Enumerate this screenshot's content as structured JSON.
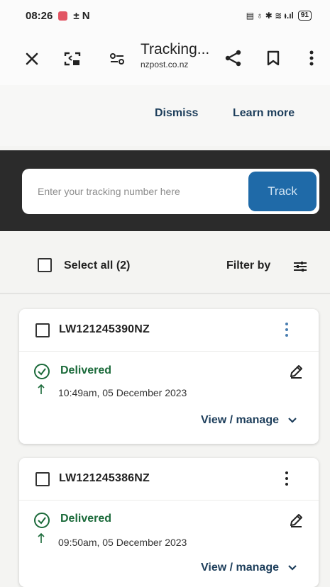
{
  "status_bar": {
    "time": "08:26",
    "left_glyphs": "± N",
    "right_glyphs": "▤ ♁ ✱ ≋ ᵻ.ıl",
    "battery": "91"
  },
  "browser": {
    "title": "Tracking...",
    "url": "nzpost.co.nz"
  },
  "banner": {
    "dismiss_label": "Dismiss",
    "learn_more_label": "Learn more"
  },
  "search": {
    "placeholder": "Enter your tracking number here",
    "track_label": "Track"
  },
  "list_controls": {
    "select_all_label": "Select all (2)",
    "filter_label": "Filter by"
  },
  "parcels": [
    {
      "tracking_number": "LW121245390NZ",
      "status": "Delivered",
      "datetime": "10:49am, 05 December 2023",
      "view_label": "View / manage"
    },
    {
      "tracking_number": "LW121245386NZ",
      "status": "Delivered",
      "datetime": "09:50am, 05 December 2023",
      "view_label": "View / manage"
    }
  ],
  "colors": {
    "accent_blue": "#1f6aa8",
    "delivered_green": "#1b6a3a",
    "link_navy": "#1d3e5b",
    "band_dark": "#2b2b2b"
  }
}
